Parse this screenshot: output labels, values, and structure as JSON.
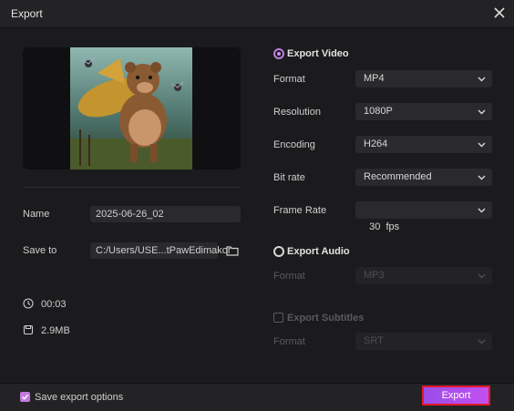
{
  "window": {
    "title": "Export"
  },
  "left": {
    "name_label": "Name",
    "name_value": "2025-06-26_02",
    "saveto_label": "Save to",
    "saveto_value": "C:/Users/USE...tPawEdimakor",
    "duration": "00:03",
    "size": "2.9MB"
  },
  "video": {
    "section_label": "Export Video",
    "format_label": "Format",
    "format_value": "MP4",
    "resolution_label": "Resolution",
    "resolution_value": "1080P",
    "encoding_label": "Encoding",
    "encoding_value": "H264",
    "bitrate_label": "Bit rate",
    "bitrate_value": "Recommended",
    "framerate_label": "Frame Rate",
    "framerate_value": "30  fps"
  },
  "audio": {
    "section_label": "Export Audio",
    "format_label": "Format",
    "format_value": "MP3"
  },
  "subtitles": {
    "section_label": "Export Subtitles",
    "format_label": "Format",
    "format_value": "SRT"
  },
  "footer": {
    "save_options_label": "Save export options",
    "export_label": "Export"
  },
  "colors": {
    "accent": "#b36be8",
    "highlight_border": "#e0182c"
  }
}
